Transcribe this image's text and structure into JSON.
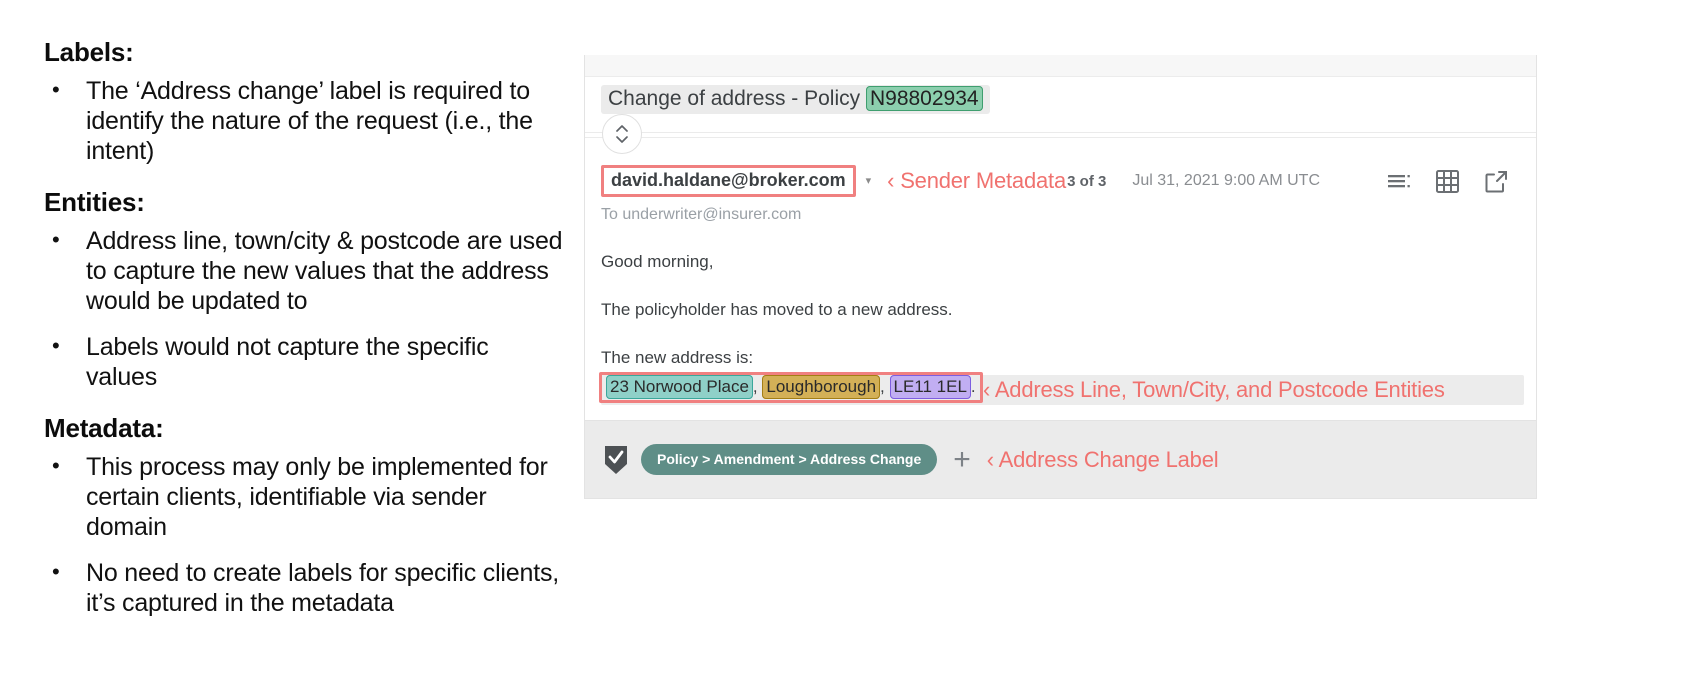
{
  "left_notes": {
    "sections": [
      {
        "heading": "Labels:",
        "bullets": [
          "The ‘Address change’ label is required to identify the nature of the request (i.e., the intent)"
        ]
      },
      {
        "heading": "Entities:",
        "bullets": [
          "Address line, town/city & postcode are used to capture the new values that the address would be updated to",
          "Labels would not capture the specific values"
        ]
      },
      {
        "heading": "Metadata:",
        "bullets": [
          "This process may only be implemented for certain clients, identifiable via sender domain",
          "No need to create labels for specific clients, it’s captured in the metadata"
        ]
      }
    ]
  },
  "email": {
    "subject_prefix": "Change of address - Policy ",
    "policy_number": "N98802934",
    "sender": "david.haldane@broker.com",
    "sender_caret": "▾",
    "recipient": "To underwriter@insurer.com",
    "message_count": "3 of 3",
    "timestamp": "Jul 31, 2021 9:00 AM UTC",
    "body": {
      "greeting": "Good morning,",
      "line_1": "The policyholder has moved to a new address.",
      "line_2": "The new address is:"
    },
    "entities": {
      "address_line": "23 Norwood Place",
      "separator_1": ", ",
      "town_city": "Loughborough",
      "separator_2": ", ",
      "postcode": "LE11 1EL",
      "terminator": "."
    },
    "toolbar_icons": [
      "list-view-icon",
      "grid-view-icon",
      "open-external-icon"
    ],
    "footer": {
      "checkbox_icon": "checked-shield-icon",
      "label_pill": "Policy > Amendment > Address Change",
      "add_label": "+"
    }
  },
  "annotations": {
    "sender": "‹ Sender Metadata",
    "entities": "‹ Address Line, Town/City, and Postcode Entities",
    "label": "‹ Address Change Label"
  },
  "colors": {
    "annotation": "#f0726f",
    "entity_policy": "#8ccfae",
    "entity_address": "#8fd0c8",
    "entity_town": "#d3b057",
    "entity_postcode": "#c1aef2",
    "label_pill": "#5f8e87",
    "highlight_outline": "#f08080"
  }
}
